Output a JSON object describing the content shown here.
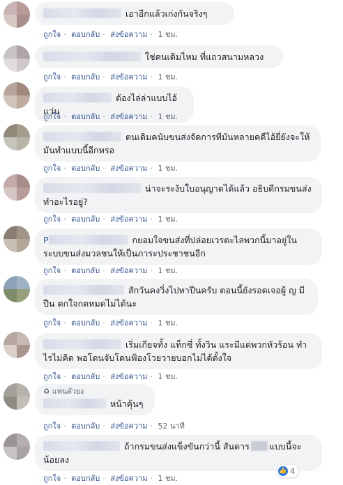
{
  "actions": {
    "like": "ถูกใจ",
    "reply": "ตอบกลับ",
    "send": "ส่งข้อความ"
  },
  "comments": [
    {
      "text": "เอาอีกแล้วเก่งกันจริงๆ",
      "time": "1 ชม."
    },
    {
      "text": "ใช่คนเดิมไหม ที่แถวสนามหลวง",
      "time": "1 ชม."
    },
    {
      "text": "ต้องไล่ล่าแบบไอ้แว่น",
      "time": "1 ชม."
    },
    {
      "text": "ตนเดิมคนับขนส่งจัดการทีมันหลายคดีไอ้ยี่ยังจะให้มันทำแบบนี้อีกหรอ",
      "time": "1 ชม."
    },
    {
      "text": "น่าจะระงับใบอนุญาตได้แล้ว อธิบดีกรมขนส่งทำอะไรอยู่?",
      "time": "1 ชม."
    },
    {
      "prefix": "P",
      "text": "กยอมใจขนส่งที่ปล่อยเวรตะไลพวกนี้มาอยู่ในระบบขนส่งมวลชนให้เป็นภาระประชาชนอีก",
      "time": "1 ชม."
    },
    {
      "text": "สักวันคงวิ่งไปหาปืนครับ ตอนนี้ยังรอดเจอผู้ ญ มีปืน ตกใจกดหมดไม่ได้นะ",
      "time": "1 ชม."
    },
    {
      "text": "เริ่มเกียจทั้ง แท็กซี่ ทั้งวิน แระมีแต่พวกหัวร้อน ทำไรไม่คิด พอโดนจับโดนฟ้องโวยวายบอกไม่ได้ตั้งใจ",
      "time": "1 ชม."
    },
    {
      "label": "♻ แฟนตัวยง",
      "text": "หน้าคุ้นๆ",
      "time": "52 นาที"
    },
    {
      "text_a": "ถ้ากรมขนส่งแข็งขันกว่านี้ สันดาร",
      "text_b": "แบบนี้จะน้อยลง",
      "time": "1 ชม.",
      "reaction_count": "4"
    }
  ],
  "colors": {
    "bubble": "#f2f3f5",
    "link": "#385898",
    "meta": "#606770",
    "like": "#2078f4"
  }
}
